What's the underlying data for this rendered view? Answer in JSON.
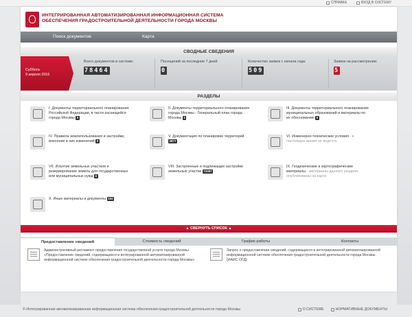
{
  "top": {
    "help": "СПРАВКА",
    "login": "ВХОД В СИСТЕМУ"
  },
  "header": {
    "line1": "ИНТЕГРИРОВАННАЯ АВТОМАТИЗИРОВАННАЯ ИНФОРМАЦИОННАЯ СИСТЕМА",
    "line2": "ОБЕСПЕЧЕНИЯ ГРАДОСТРОИТЕЛЬНОЙ ДЕЯТЕЛЬНОСТИ ГОРОДА МОСКВЫ"
  },
  "nav": {
    "search": "Поиск документов",
    "map": "Карта"
  },
  "summary": {
    "title": "СВОДНЫЕ СВЕДЕНИЯ",
    "day": "Суббота",
    "date": "9 апреля 2016",
    "docs_label": "Всего документов в системе:",
    "docs_value": "78464",
    "visits_label": "Посещений за последние 7 дней:",
    "visits_value": "0",
    "requests_label": "Количество заявок с начала года:",
    "requests_value": "509",
    "review_label": "Заявок на рассмотрении:",
    "review_value": "5"
  },
  "sections": {
    "title": "РАЗДЕЛЫ",
    "s1": "I. Документы территориального планирования Российской Федерации, в части касающейся города Москвы",
    "s1b": "0",
    "s2": "II. Документы территориального планирования города Москвы - Генеральный план города Москвы",
    "s2b": "1",
    "s3": "III. Документы территориального планирования муниципальных образований и материалы по их обоснованию",
    "s3b": "0",
    "s4": "IV. Правила землепользования и застройки, внесение в них изменений",
    "s4b": "0",
    "s5": "V. Документация по планировке территорий",
    "s5b": "3877",
    "s6": "VI. Инженерно-технические условия",
    "s6m": "- в настоящее время не ведется",
    "s7": "VII. Изъятие земельных участков и резервирование земель для государственных или муниципальных нужд",
    "s7b": "0",
    "s8": "VIII. Застроенные и подлежащие застройке земельные участки",
    "s8b": "73397",
    "s9": "IX. Геодезические и картографические материалы",
    "s9m": "- материалы данного раздела опубликованы на карте",
    "s10": "X. Иные материалы и документы",
    "s10b": "192"
  },
  "collapse": "▲ СВЕРНУТЬ СПИСОК ▲",
  "tabs": {
    "t1": "Предоставление сведений",
    "t2": "Стоимость сведений",
    "t3": "График работы",
    "t4": "Контакты"
  },
  "info": {
    "a": "Административный регламент предоставления государственной услуги города Москвы «Предоставление сведений, содержащихся в интегрированной автоматизированной информационной системе обеспечения градостроительной деятельности города Москвы»",
    "b": "Запрос о предоставлении сведений, содержащихся в интегрированной автоматизированной информационной системе обеспечения градостроительной деятельности города Москвы (ИАИС ОГД)"
  },
  "footer": {
    "copy": "© Интегрированная автоматизированная информационная система обеспечения градостроительной деятельности города Москвы",
    "about": "О СИСТЕМЕ",
    "docs": "НОРМАТИВНЫЕ ДОКУМЕНТЫ"
  }
}
